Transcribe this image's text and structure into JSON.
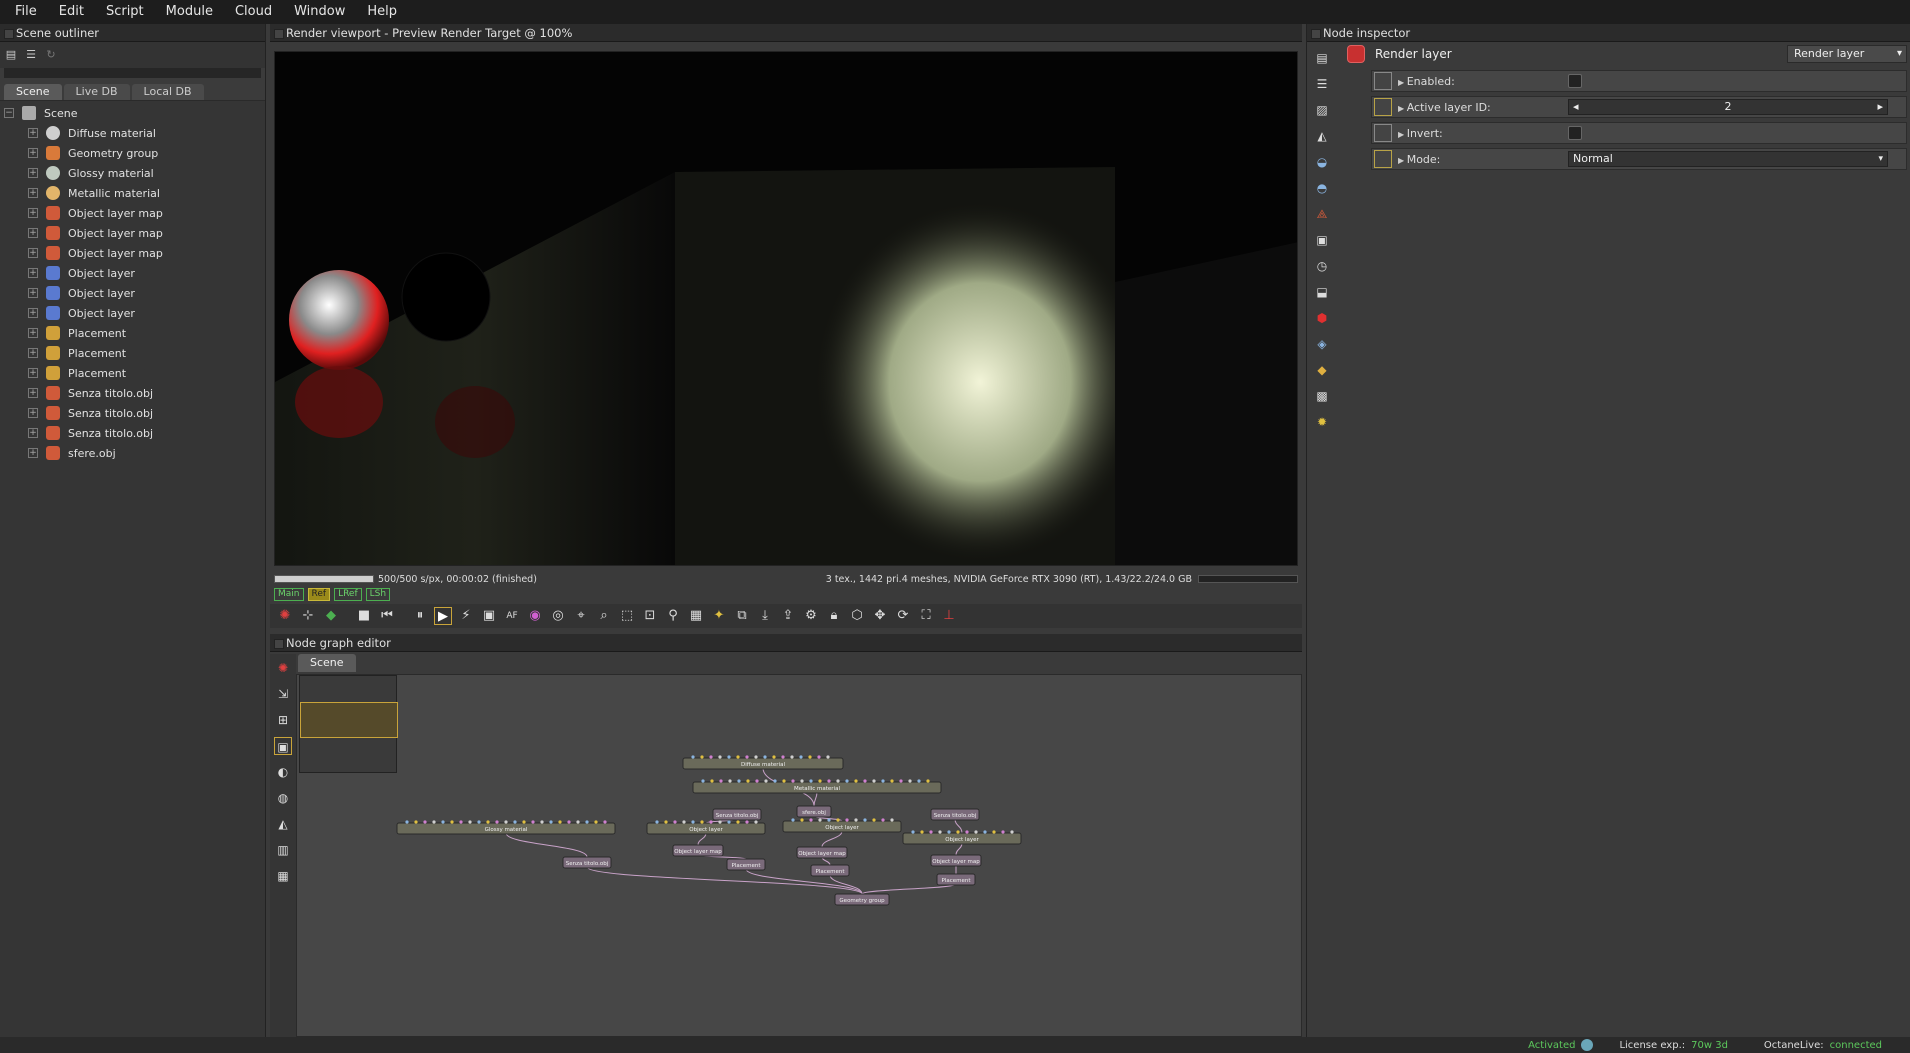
{
  "menu": [
    "File",
    "Edit",
    "Script",
    "Module",
    "Cloud",
    "Window",
    "Help"
  ],
  "outliner": {
    "title": "Scene outliner",
    "tabs": [
      "Scene",
      "Live DB",
      "Local DB"
    ],
    "root": "Scene",
    "items": [
      {
        "label": "Diffuse material",
        "icon": "diffuse-material-icon",
        "color": "#cfcfcf"
      },
      {
        "label": "Geometry group",
        "icon": "geometry-group-icon",
        "color": "#d97a3a"
      },
      {
        "label": "Glossy material",
        "icon": "glossy-material-icon",
        "color": "#bfc9bf"
      },
      {
        "label": "Metallic material",
        "icon": "metallic-material-icon",
        "color": "#e2b56a"
      },
      {
        "label": "Object layer map",
        "icon": "object-layer-map-icon",
        "color": "#d05a3a"
      },
      {
        "label": "Object layer map",
        "icon": "object-layer-map-icon",
        "color": "#d05a3a"
      },
      {
        "label": "Object layer map",
        "icon": "object-layer-map-icon",
        "color": "#d05a3a"
      },
      {
        "label": "Object layer",
        "icon": "object-layer-icon",
        "color": "#5a7ad0"
      },
      {
        "label": "Object layer",
        "icon": "object-layer-icon",
        "color": "#5a7ad0"
      },
      {
        "label": "Object layer",
        "icon": "object-layer-icon",
        "color": "#5a7ad0"
      },
      {
        "label": "Placement",
        "icon": "placement-icon",
        "color": "#d0a03a"
      },
      {
        "label": "Placement",
        "icon": "placement-icon",
        "color": "#d0a03a"
      },
      {
        "label": "Placement",
        "icon": "placement-icon",
        "color": "#d0a03a"
      },
      {
        "label": "Senza titolo.obj",
        "icon": "mesh-icon",
        "color": "#d05a3a"
      },
      {
        "label": "Senza titolo.obj",
        "icon": "mesh-icon",
        "color": "#d05a3a"
      },
      {
        "label": "Senza titolo.obj",
        "icon": "mesh-icon",
        "color": "#d05a3a"
      },
      {
        "label": "sfere.obj",
        "icon": "mesh-icon",
        "color": "#d05a3a"
      }
    ]
  },
  "viewport": {
    "title": "Render viewport - Preview Render Target @ 100%",
    "progress_text": "500/500 s/px, 00:00:02 (finished)",
    "progress": 1.0,
    "stats": "3 tex., 1442 pri.4 meshes, NVIDIA GeForce RTX 3090 (RT), 1.43/22.2/24.0 GB",
    "render_tabs": [
      "Main",
      "Ref",
      "LRef",
      "LSh"
    ]
  },
  "nodegraph": {
    "title": "Node graph editor",
    "tab": "Scene",
    "nodes": [
      {
        "label": "Diffuse material"
      },
      {
        "label": "Metallic material"
      },
      {
        "label": "Glossy material"
      },
      {
        "label": "Senza titolo.obj"
      },
      {
        "label": "sfere.obj"
      },
      {
        "label": "Senza titolo.obj"
      },
      {
        "label": "Object layer"
      },
      {
        "label": "Object layer"
      },
      {
        "label": "Object layer"
      },
      {
        "label": "Object layer map"
      },
      {
        "label": "Object layer map"
      },
      {
        "label": "Object layer map"
      },
      {
        "label": "Senza titolo.obj"
      },
      {
        "label": "Placement"
      },
      {
        "label": "Placement"
      },
      {
        "label": "Placement"
      },
      {
        "label": "Geometry group"
      }
    ]
  },
  "inspector": {
    "title": "Node inspector",
    "node_name": "Render layer",
    "node_type": "Render layer",
    "attrs": {
      "enabled": "Enabled:",
      "active_layer": "Active layer ID:",
      "active_layer_value": "2",
      "invert": "Invert:",
      "mode": "Mode:",
      "mode_value": "Normal"
    }
  },
  "status": {
    "activated": "Activated",
    "license_label": "License exp.:",
    "license_value": "70w 3d",
    "octanelive_label": "OctaneLive:",
    "octanelive_value": "connected"
  },
  "colors": {
    "accent": "#c9a43a",
    "ok": "#5cc85c",
    "wire": "#c9a3c9"
  }
}
